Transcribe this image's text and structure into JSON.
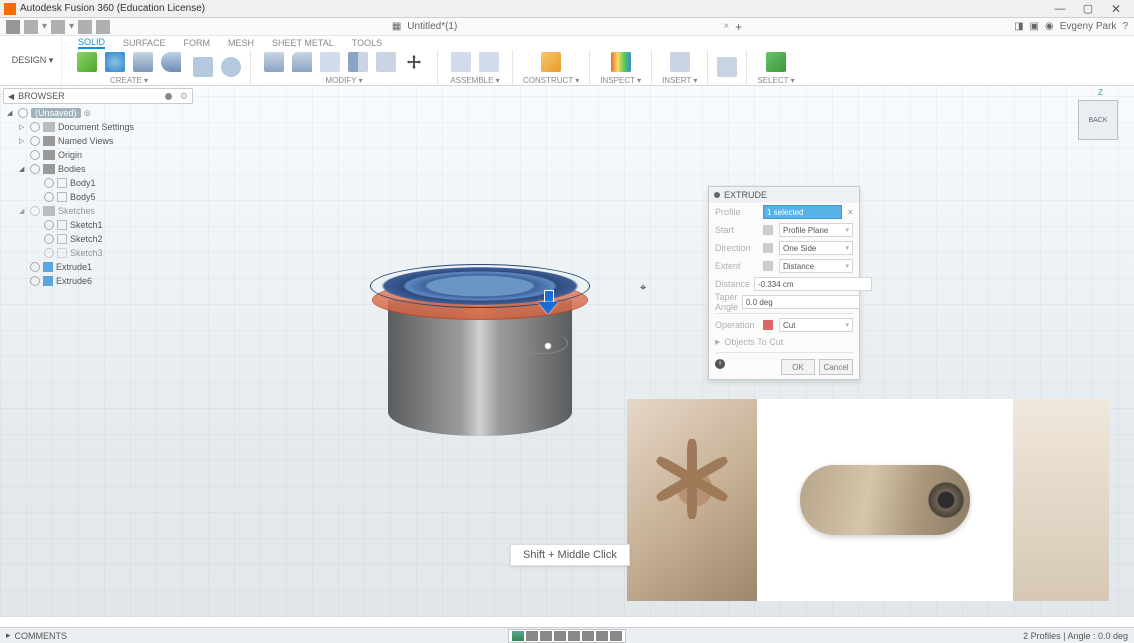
{
  "titlebar": {
    "title": "Autodesk Fusion 360 (Education License)"
  },
  "quickbar": {
    "doc_title": "Untitled*(1)",
    "user": "Evgeny Park"
  },
  "ribbon": {
    "design_label": "DESIGN ▾",
    "tabs": [
      "SOLID",
      "SURFACE",
      "FORM",
      "MESH",
      "SHEET METAL",
      "TOOLS"
    ],
    "active_tab": 0,
    "groups": [
      "CREATE ▾",
      "MODIFY ▾",
      "ASSEMBLE ▾",
      "CONSTRUCT ▾",
      "INSPECT ▾",
      "INSERT ▾",
      "SELECT ▾"
    ]
  },
  "browser": {
    "header": "BROWSER",
    "root": "(Unsaved)",
    "items": [
      {
        "label": "Document Settings",
        "indent": 1,
        "caret": "▷",
        "folder": false
      },
      {
        "label": "Named Views",
        "indent": 1,
        "caret": "▷",
        "folder": true
      },
      {
        "label": "Origin",
        "indent": 1,
        "caret": "",
        "folder": true
      },
      {
        "label": "Bodies",
        "indent": 1,
        "caret": "◢",
        "folder": true
      },
      {
        "label": "Body1",
        "indent": 2,
        "caret": "",
        "folder": false,
        "box": true
      },
      {
        "label": "Body5",
        "indent": 2,
        "caret": "",
        "folder": false,
        "box": true
      },
      {
        "label": "Sketches",
        "indent": 1,
        "caret": "◢",
        "folder": true,
        "dim": true
      },
      {
        "label": "Sketch1",
        "indent": 2,
        "caret": "",
        "folder": false,
        "box": true
      },
      {
        "label": "Sketch2",
        "indent": 2,
        "caret": "",
        "folder": false,
        "box": true
      },
      {
        "label": "Sketch3",
        "indent": 2,
        "caret": "",
        "folder": false,
        "box": true,
        "dim": true
      },
      {
        "label": "Extrude1",
        "indent": 1,
        "caret": "",
        "folder": false,
        "blue": true
      },
      {
        "label": "Extrude6",
        "indent": 1,
        "caret": "",
        "folder": false,
        "blue": true
      }
    ]
  },
  "viewcube": {
    "face": "BACK",
    "axis": "Z"
  },
  "dialog": {
    "title": "EXTRUDE",
    "rows": {
      "profile_label": "Profile",
      "profile_value": "1 selected",
      "start_label": "Start",
      "start_value": "Profile Plane",
      "direction_label": "Direction",
      "direction_value": "One Side",
      "extent_label": "Extent",
      "extent_value": "Distance",
      "distance_label": "Distance",
      "distance_value": "-0.334 cm",
      "taper_label": "Taper Angle",
      "taper_value": "0.0 deg",
      "operation_label": "Operation",
      "operation_value": "Cut",
      "objects_label": "Objects To Cut"
    },
    "ok": "OK",
    "cancel": "Cancel"
  },
  "tooltip": "Shift + Middle Click",
  "statusbar": {
    "comments": "COMMENTS",
    "right": "2 Profiles | Angle : 0.0 deg"
  }
}
